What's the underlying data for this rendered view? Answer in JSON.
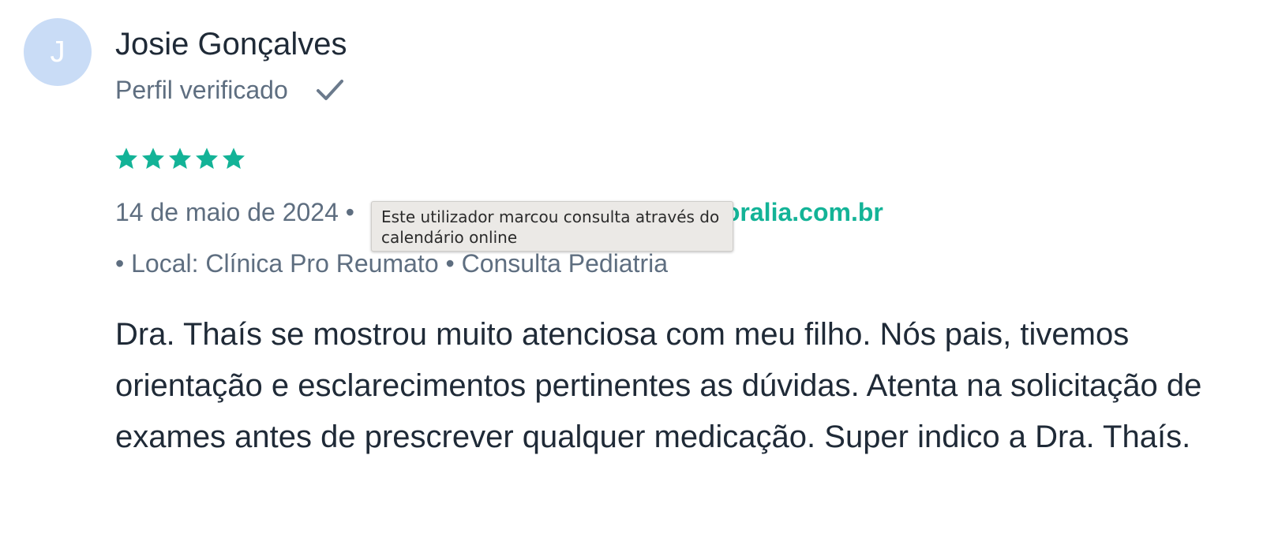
{
  "review": {
    "avatar_initial": "J",
    "author_name": "Josie Gonçalves",
    "verified_label": "Perfil verificado",
    "verified_icon": "checkmark-icon",
    "rating": 5,
    "rating_max": 5,
    "star_color": "#13b397",
    "date": "14 de maio de 2024",
    "separator": "•",
    "source_visible_text": "oralia.com.br",
    "location_line": "• Local: Clínica Pro Reumato • Consulta Pediatria",
    "tooltip": "Este utilizador marcou consulta através do calendário online",
    "body": "Dra. Thaís se mostrou muito atenciosa com meu filho. Nós pais, tivemos orientação e esclarecimentos pertinentes as dúvidas. Atenta na solicitação de exames antes de prescrever qualquer medicação. Super indico a Dra. Thaís."
  },
  "colors": {
    "accent": "#13b397",
    "text_primary": "#1f2a37",
    "text_secondary": "#5e6e80",
    "avatar_bg": "#c9dcf6"
  }
}
